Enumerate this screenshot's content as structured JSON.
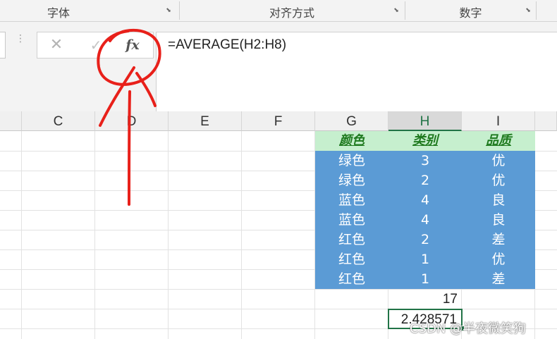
{
  "ribbon": {
    "groups": [
      {
        "label": "字体"
      },
      {
        "label": "对齐方式"
      },
      {
        "label": "数字"
      }
    ]
  },
  "formula_bar": {
    "cancel_icon": "✕",
    "enter_icon": "✓",
    "fx_label": "fx",
    "formula": "=AVERAGE(H2:H8)",
    "dots": "⋮"
  },
  "columns": [
    "C",
    "D",
    "E",
    "F",
    "G",
    "H",
    "I"
  ],
  "active_column": "H",
  "table": {
    "headers": [
      "颜色",
      "类别",
      "品质"
    ],
    "rows": [
      [
        "绿色",
        "3",
        "优"
      ],
      [
        "绿色",
        "2",
        "优"
      ],
      [
        "蓝色",
        "4",
        "良"
      ],
      [
        "蓝色",
        "4",
        "良"
      ],
      [
        "红色",
        "2",
        "差"
      ],
      [
        "红色",
        "1",
        "优"
      ],
      [
        "红色",
        "1",
        "差"
      ]
    ]
  },
  "sum_value": "17",
  "average_value": "2.428571",
  "watermark": "CSDN @半夜微笑狗",
  "colors": {
    "header_fill": "#c6efce",
    "header_text": "#1f7a1f",
    "data_fill": "#5b9bd5",
    "selection": "#217346",
    "annotation": "#e8201a"
  }
}
